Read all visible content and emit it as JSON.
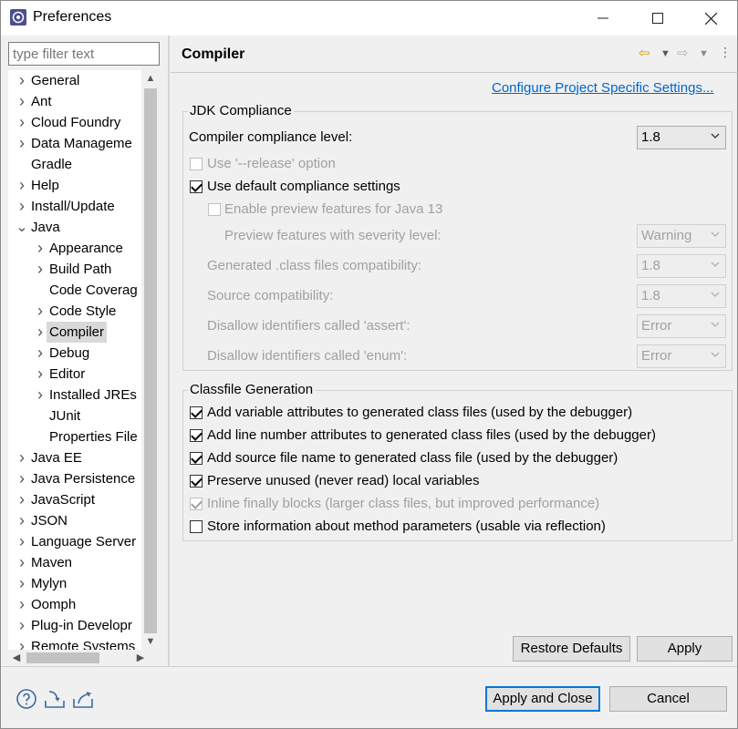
{
  "window": {
    "title": "Preferences"
  },
  "filter": {
    "placeholder": "type filter text"
  },
  "tree": [
    {
      "label": "General",
      "arrow": "right"
    },
    {
      "label": "Ant",
      "arrow": "right"
    },
    {
      "label": "Cloud Foundry",
      "arrow": "right"
    },
    {
      "label": "Data Manageme",
      "arrow": "right"
    },
    {
      "label": "Gradle",
      "arrow": ""
    },
    {
      "label": "Help",
      "arrow": "right"
    },
    {
      "label": "Install/Update",
      "arrow": "right"
    },
    {
      "label": "Java",
      "arrow": "down"
    },
    {
      "label": "Appearance",
      "arrow": "right"
    },
    {
      "label": "Build Path",
      "arrow": "right"
    },
    {
      "label": "Code Coverag",
      "arrow": ""
    },
    {
      "label": "Code Style",
      "arrow": "right"
    },
    {
      "label": "Compiler",
      "arrow": "right"
    },
    {
      "label": "Debug",
      "arrow": "right"
    },
    {
      "label": "Editor",
      "arrow": "right"
    },
    {
      "label": "Installed JREs",
      "arrow": "right"
    },
    {
      "label": "JUnit",
      "arrow": ""
    },
    {
      "label": "Properties File",
      "arrow": ""
    },
    {
      "label": "Java EE",
      "arrow": "right"
    },
    {
      "label": "Java Persistence",
      "arrow": "right"
    },
    {
      "label": "JavaScript",
      "arrow": "right"
    },
    {
      "label": "JSON",
      "arrow": "right"
    },
    {
      "label": "Language Server",
      "arrow": "right"
    },
    {
      "label": "Maven",
      "arrow": "right"
    },
    {
      "label": "Mylyn",
      "arrow": "right"
    },
    {
      "label": "Oomph",
      "arrow": "right"
    },
    {
      "label": "Plug-in Developr",
      "arrow": "right"
    },
    {
      "label": "Remote Systems",
      "arrow": "right"
    }
  ],
  "page": {
    "title": "Compiler",
    "configure_link": "Configure Project Specific Settings..."
  },
  "jdk": {
    "group_title": "JDK Compliance",
    "compliance_label": "Compiler compliance level:",
    "compliance_value": "1.8",
    "release_option": "Use '--release' option",
    "use_default": "Use default compliance settings",
    "enable_preview": "Enable preview features for Java 13",
    "preview_severity_label": "Preview features with severity level:",
    "preview_severity_value": "Warning",
    "generated_label": "Generated .class files compatibility:",
    "generated_value": "1.8",
    "source_label": "Source compatibility:",
    "source_value": "1.8",
    "assert_label": "Disallow identifiers called 'assert':",
    "assert_value": "Error",
    "enum_label": "Disallow identifiers called 'enum':",
    "enum_value": "Error"
  },
  "classfile": {
    "group_title": "Classfile Generation",
    "opt1": "Add variable attributes to generated class files (used by the debugger)",
    "opt2": "Add line number attributes to generated class files (used by the debugger)",
    "opt3": "Add source file name to generated class file (used by the debugger)",
    "opt4": "Preserve unused (never read) local variables",
    "opt5": "Inline finally blocks (larger class files, but improved performance)",
    "opt6": "Store information about method parameters (usable via reflection)"
  },
  "buttons": {
    "restore": "Restore Defaults",
    "apply": "Apply",
    "apply_close": "Apply and Close",
    "cancel": "Cancel"
  }
}
